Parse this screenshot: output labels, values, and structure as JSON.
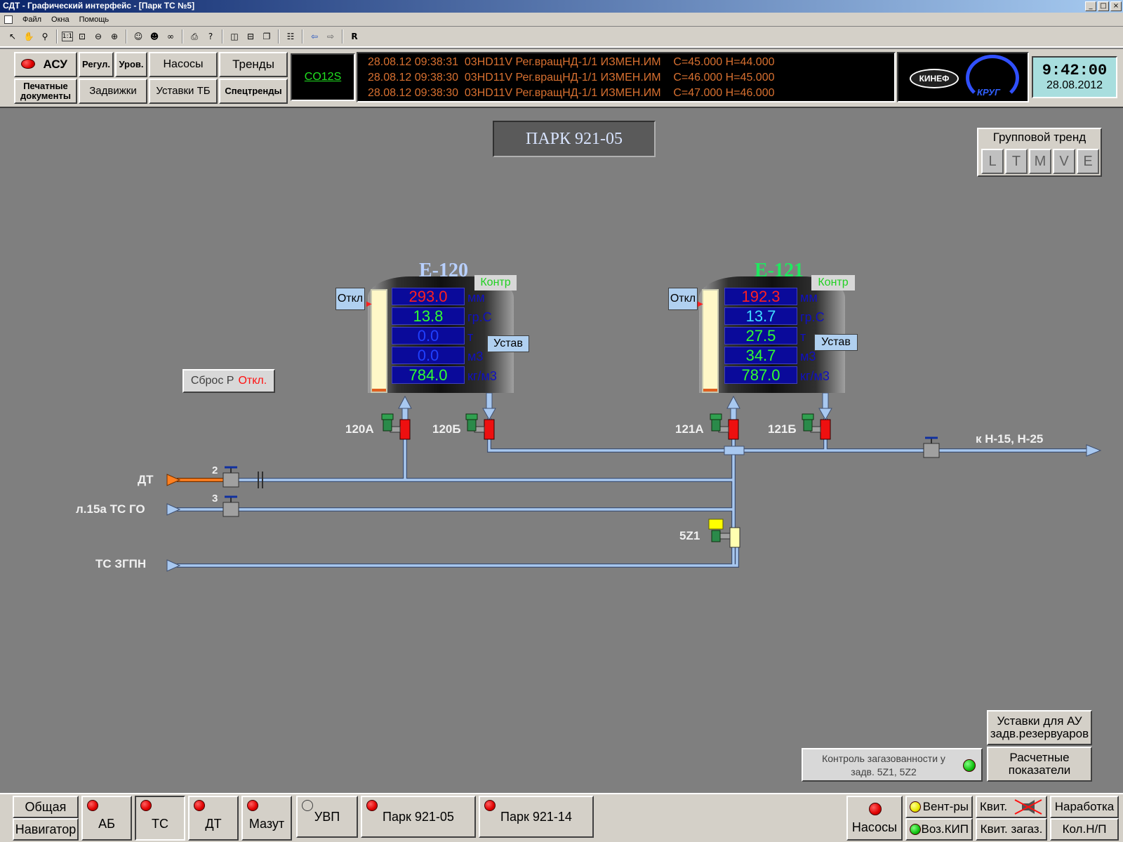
{
  "window": {
    "title": "СДТ - Графический интерфейс - [Парк ТС №5]",
    "controls": [
      "_",
      "□",
      "×"
    ]
  },
  "menu": {
    "items": [
      "Файл",
      "Окна",
      "Помощь"
    ]
  },
  "header": {
    "buttons": {
      "asu": "АСУ",
      "regul": "Регул.",
      "urov": "Уров.",
      "nasosy": "Насосы",
      "trendy": "Тренды",
      "pechat": "Печатные документы",
      "zadvizhki": "Задвижки",
      "ustavki_tb": "Уставки ТБ",
      "spectrendy": "Спецтренды"
    },
    "code": "CO12S",
    "log": [
      "28.08.12 09:38:31  03HD11V Рег.вращНД-1/1 ИЗМЕН.ИМ    С=45.000 Н=44.000",
      "28.08.12 09:38:30  03HD11V Рег.вращНД-1/1 ИЗМЕН.ИМ    С=46.000 Н=45.000",
      "28.08.12 09:38:30  03HD11V Рег.вращНД-1/1 ИЗМЕН.ИМ    С=47.000 Н=46.000"
    ],
    "logo1": "КИНЕФ",
    "logo2": "КРУГ",
    "clock": {
      "time": "9:42:00",
      "date": "28.08.2012"
    }
  },
  "main": {
    "park_title": "ПАРК 921-05",
    "group_trend": {
      "title": "Групповой тренд",
      "buttons": [
        "L",
        "T",
        "M",
        "V",
        "E"
      ]
    },
    "reset": {
      "label": "Сброс Р",
      "state": "Откл."
    },
    "tanks": [
      {
        "name": "Е-120",
        "otkl": "Откл",
        "kontr": "Контр",
        "ustav": "Устав",
        "values": [
          "293.0",
          "13.8",
          "0.0",
          "0.0",
          "784.0"
        ],
        "units": [
          "мм",
          "гр.С",
          "т",
          "м3",
          "кг/м3"
        ],
        "value_colors": [
          "#ff2020",
          "#30ff30",
          "#2040ff",
          "#2040ff",
          "#30ff30"
        ],
        "name_color": "#b8d0ff",
        "level_fraction": 0.03,
        "valves": [
          "120А",
          "120Б"
        ]
      },
      {
        "name": "Е-121",
        "otkl": "Откл",
        "kontr": "Контр",
        "ustav": "Устав",
        "values": [
          "192.3",
          "13.7",
          "27.5",
          "34.7",
          "787.0"
        ],
        "units": [
          "мм",
          "гр.С",
          "т",
          "м3",
          "кг/м3"
        ],
        "value_colors": [
          "#ff2020",
          "#40e0ff",
          "#30ff30",
          "#30ff30",
          "#30ff30"
        ],
        "name_color": "#20e860",
        "level_fraction": 0.03,
        "valves": [
          "121А",
          "121Б"
        ]
      }
    ],
    "lines": {
      "dt": "ДТ",
      "l15": "л.15а ТС ГО",
      "tszgpn": "ТС ЗГПН",
      "out": "к Н-15, Н-25",
      "n2": "2",
      "n3": "3",
      "v5z1": "5Z1"
    },
    "gas_control": "Контроль загазованности у задв. 5Z1, 5Z2",
    "ustavki_au": "Уставки для АУ задв.резервуаров",
    "raschet": "Расчетные показатели"
  },
  "footer": {
    "obshaya": "Общая",
    "navigator": "Навигатор",
    "tabs": [
      "АБ",
      "ТС",
      "ДТ",
      "Мазут",
      "УВП",
      "Парк 921-05",
      "Парк 921-14"
    ],
    "nasosy": "Насосы",
    "vent": "Вент-ры",
    "voz_kip": "Воз.КИП",
    "kvit": "Квит.",
    "kvit_zagaz": "Квит. загаз.",
    "narabotka": "Наработка",
    "kol_np": "Кол.Н/П"
  },
  "colors": {
    "pipe": "#a8c8f0",
    "pipe_dt": "#ff8020",
    "valve_red": "#ee1010",
    "tank_body": "#202020"
  }
}
